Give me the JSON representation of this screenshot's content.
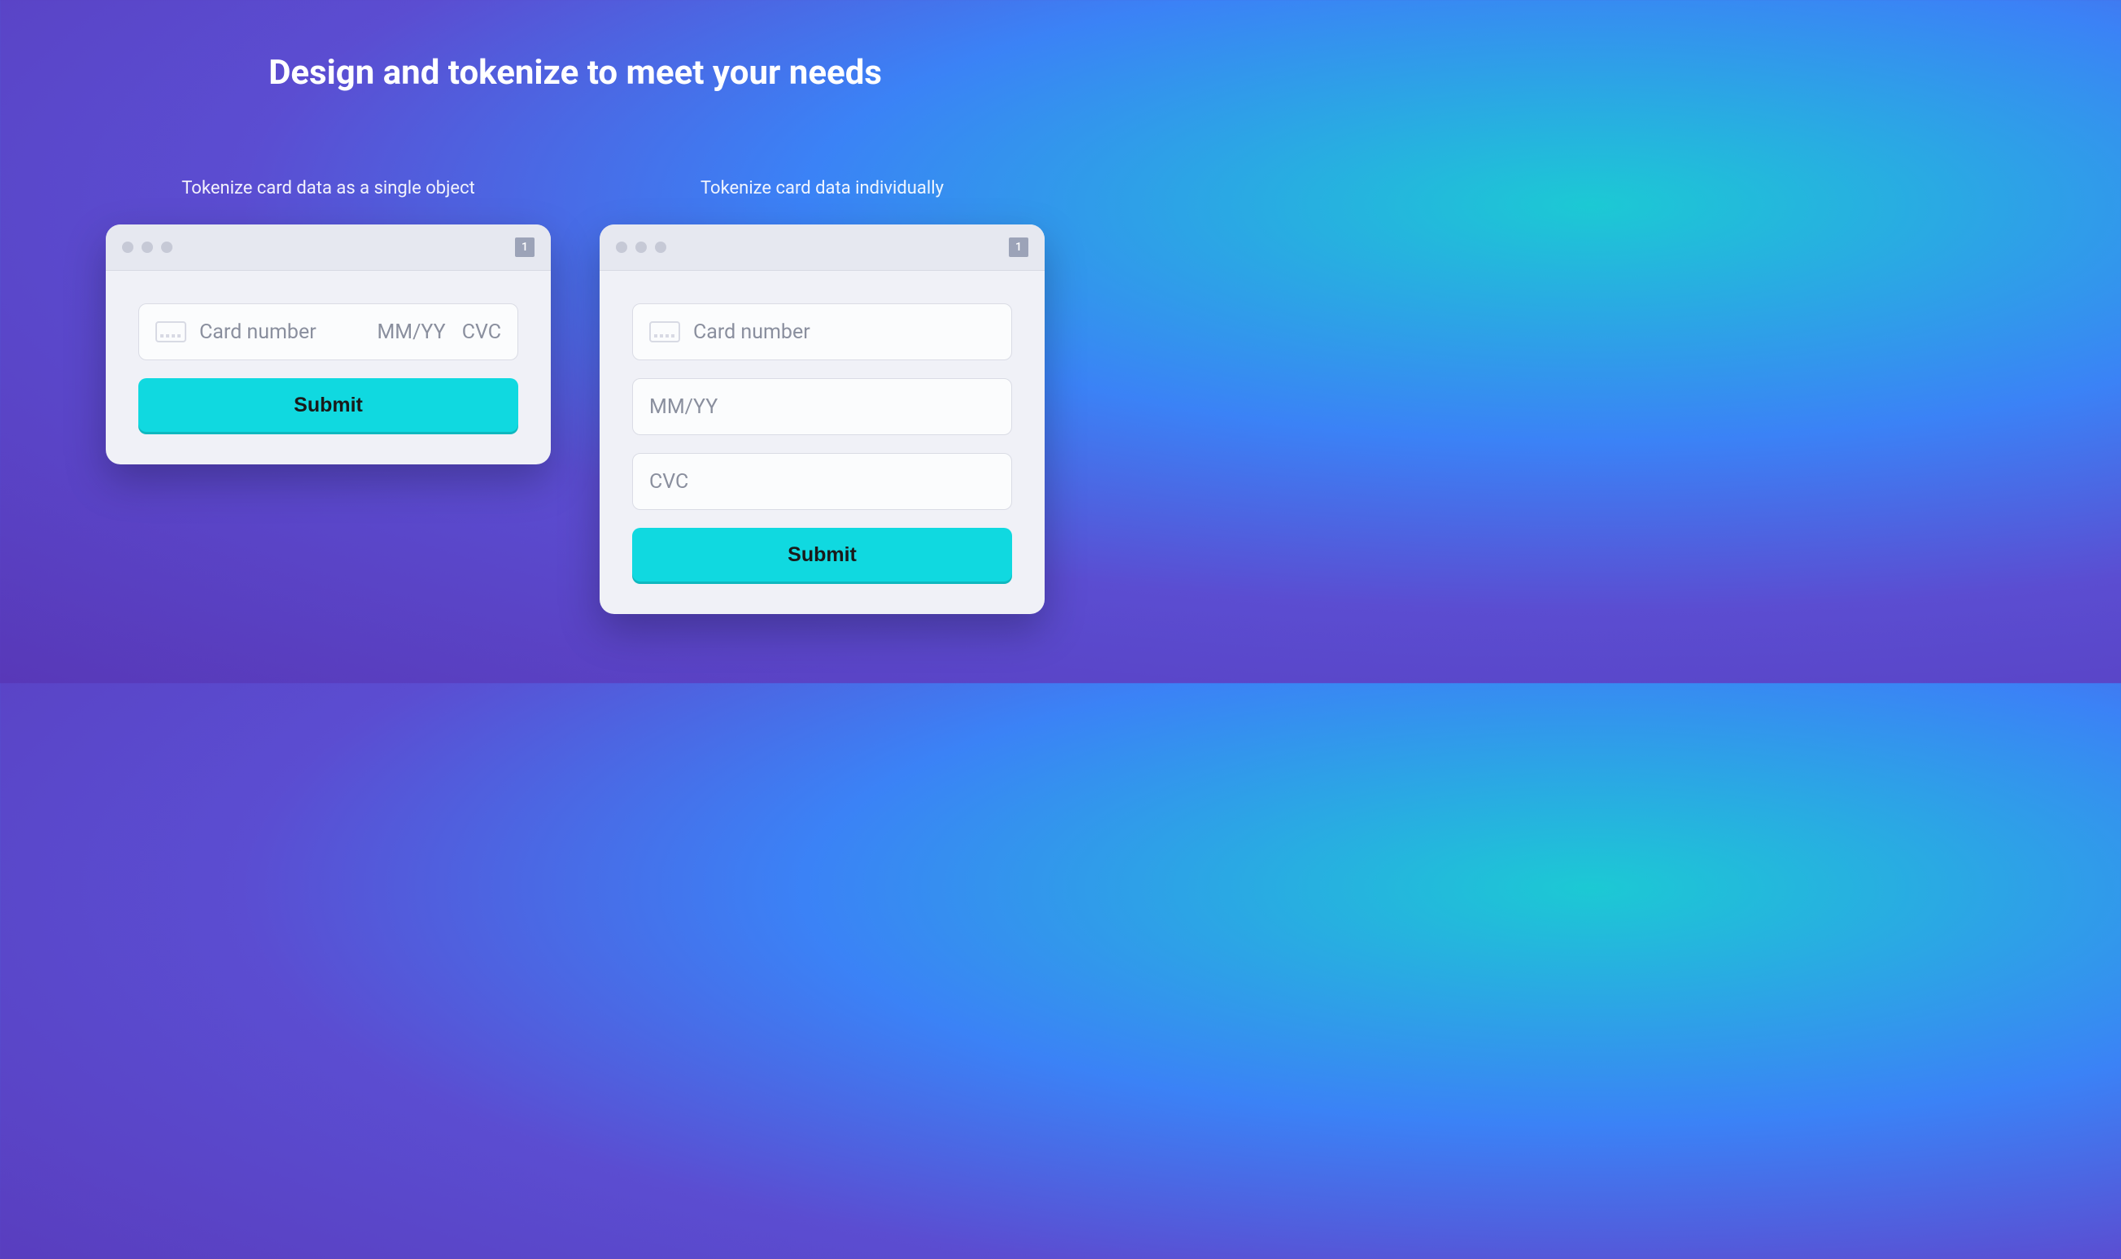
{
  "page": {
    "title": "Design and tokenize to meet your needs"
  },
  "sections": {
    "left": {
      "label": "Tokenize card data as a single object",
      "window_badge": "1",
      "inputs": {
        "card_number_placeholder": "Card number",
        "exp_placeholder": "MM/YY",
        "cvc_placeholder": "CVC"
      },
      "submit_label": "Submit"
    },
    "right": {
      "label": "Tokenize card data individually",
      "window_badge": "1",
      "inputs": {
        "card_number_placeholder": "Card number",
        "exp_placeholder": "MM/YY",
        "cvc_placeholder": "CVC"
      },
      "submit_label": "Submit"
    }
  }
}
